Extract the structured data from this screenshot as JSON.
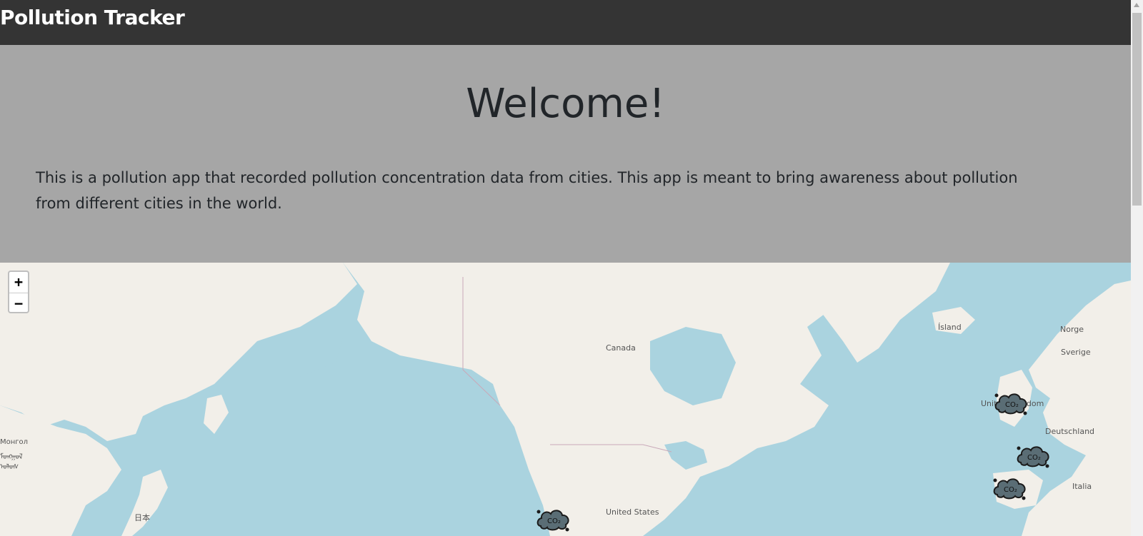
{
  "navbar": {
    "brand": "Pollution Tracker"
  },
  "hero": {
    "title": "Welcome!",
    "description": "This is a pollution app that recorded pollution concentration data from cities. This app is meant to bring awareness about pollution from different cities in the world."
  },
  "map": {
    "zoom_in": "+",
    "zoom_out": "−",
    "labels": {
      "canada": "Canada",
      "united_states": "United States",
      "island": "Ísland",
      "norge": "Norge",
      "sverige": "Sverige",
      "united_kingdom": "United Kingdom",
      "deutschland": "Deutschland",
      "italia": "Italia",
      "nihon": "日本",
      "mongol_1": "Монгол",
      "mongol_2": "ᠮᠣᠩᠭᠣᠯ",
      "mongol_3": "ᠤᠯᠤᠰ"
    },
    "marker_text": "CO₂",
    "colors": {
      "water": "#aad3df",
      "land": "#f2efe9",
      "marker": "#5a6d75"
    }
  }
}
